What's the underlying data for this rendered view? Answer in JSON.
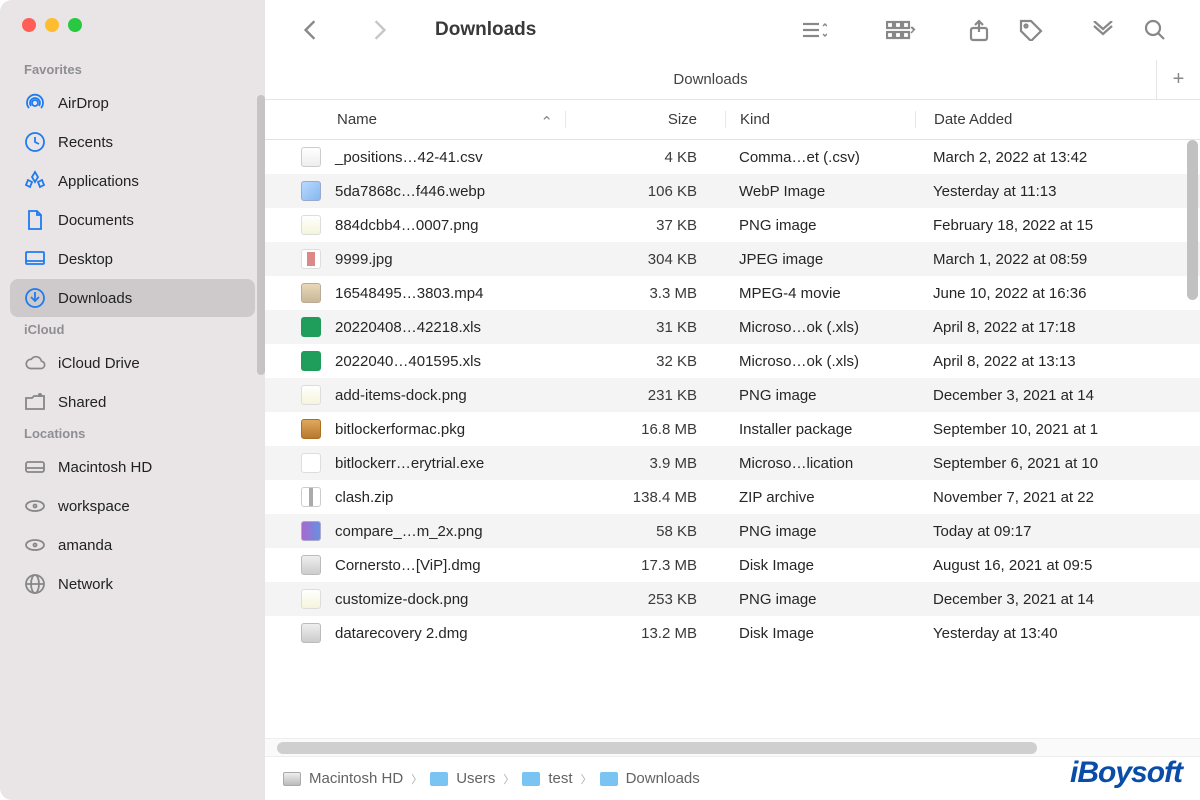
{
  "window_title": "Downloads",
  "tab_title": "Downloads",
  "sidebar": {
    "sections": [
      {
        "label": "Favorites",
        "items": [
          {
            "name": "airdrop",
            "label": "AirDrop",
            "icon": "airdrop"
          },
          {
            "name": "recents",
            "label": "Recents",
            "icon": "clock"
          },
          {
            "name": "applications",
            "label": "Applications",
            "icon": "apps"
          },
          {
            "name": "documents",
            "label": "Documents",
            "icon": "doc"
          },
          {
            "name": "desktop",
            "label": "Desktop",
            "icon": "desktop"
          },
          {
            "name": "downloads",
            "label": "Downloads",
            "icon": "download",
            "active": true
          }
        ]
      },
      {
        "label": "iCloud",
        "items": [
          {
            "name": "iclouddrive",
            "label": "iCloud Drive",
            "icon": "cloud",
            "gray": true
          },
          {
            "name": "shared",
            "label": "Shared",
            "icon": "sharedfolder",
            "gray": true
          }
        ]
      },
      {
        "label": "Locations",
        "items": [
          {
            "name": "macintoshhd",
            "label": "Macintosh HD",
            "icon": "disk",
            "gray": true
          },
          {
            "name": "workspace",
            "label": "workspace",
            "icon": "extdisk",
            "gray": true
          },
          {
            "name": "amanda",
            "label": "amanda",
            "icon": "extdisk",
            "gray": true
          },
          {
            "name": "network",
            "label": "Network",
            "icon": "globe",
            "gray": true
          }
        ]
      }
    ]
  },
  "columns": {
    "name": "Name",
    "size": "Size",
    "kind": "Kind",
    "date": "Date Added"
  },
  "files": [
    {
      "ico": "ico-doc",
      "name": "_positions…42-41.csv",
      "size": "4 KB",
      "kind": "Comma…et (.csv)",
      "date": "March 2, 2022 at 13:42"
    },
    {
      "ico": "ico-webp",
      "name": "5da7868c…f446.webp",
      "size": "106 KB",
      "kind": "WebP Image",
      "date": "Yesterday at 11:13"
    },
    {
      "ico": "ico-png",
      "name": "884dcbb4…0007.png",
      "size": "37 KB",
      "kind": "PNG image",
      "date": "February 18, 2022 at 15"
    },
    {
      "ico": "ico-jpg",
      "name": "9999.jpg",
      "size": "304 KB",
      "kind": "JPEG image",
      "date": "March 1, 2022 at 08:59"
    },
    {
      "ico": "ico-mp4",
      "name": "16548495…3803.mp4",
      "size": "3.3 MB",
      "kind": "MPEG-4 movie",
      "date": "June 10, 2022 at 16:36"
    },
    {
      "ico": "ico-xls",
      "name": "20220408…42218.xls",
      "size": "31 KB",
      "kind": "Microso…ok (.xls)",
      "date": "April 8, 2022 at 17:18"
    },
    {
      "ico": "ico-xls",
      "name": "2022040…401595.xls",
      "size": "32 KB",
      "kind": "Microso…ok (.xls)",
      "date": "April 8, 2022 at 13:13"
    },
    {
      "ico": "ico-png",
      "name": "add-items-dock.png",
      "size": "231 KB",
      "kind": "PNG image",
      "date": "December 3, 2021 at 14"
    },
    {
      "ico": "ico-pkg",
      "name": "bitlockerformac.pkg",
      "size": "16.8 MB",
      "kind": "Installer package",
      "date": "September 10, 2021 at 1"
    },
    {
      "ico": "ico-exe",
      "name": "bitlockerr…erytrial.exe",
      "size": "3.9 MB",
      "kind": "Microso…lication",
      "date": "September 6, 2021 at 10"
    },
    {
      "ico": "ico-zip",
      "name": "clash.zip",
      "size": "138.4 MB",
      "kind": "ZIP archive",
      "date": "November 7, 2021 at 22"
    },
    {
      "ico": "ico-cmp",
      "name": "compare_…m_2x.png",
      "size": "58 KB",
      "kind": "PNG image",
      "date": "Today at 09:17"
    },
    {
      "ico": "ico-dmg",
      "name": "Cornersto…[ViP].dmg",
      "size": "17.3 MB",
      "kind": "Disk Image",
      "date": "August 16, 2021 at 09:5"
    },
    {
      "ico": "ico-png",
      "name": "customize-dock.png",
      "size": "253 KB",
      "kind": "PNG image",
      "date": "December 3, 2021 at 14"
    },
    {
      "ico": "ico-dmg",
      "name": "datarecovery 2.dmg",
      "size": "13.2 MB",
      "kind": "Disk Image",
      "date": "Yesterday at 13:40"
    }
  ],
  "pathbar": [
    "Macintosh HD",
    "Users",
    "test",
    "Downloads"
  ],
  "watermark": "iBoysoft"
}
